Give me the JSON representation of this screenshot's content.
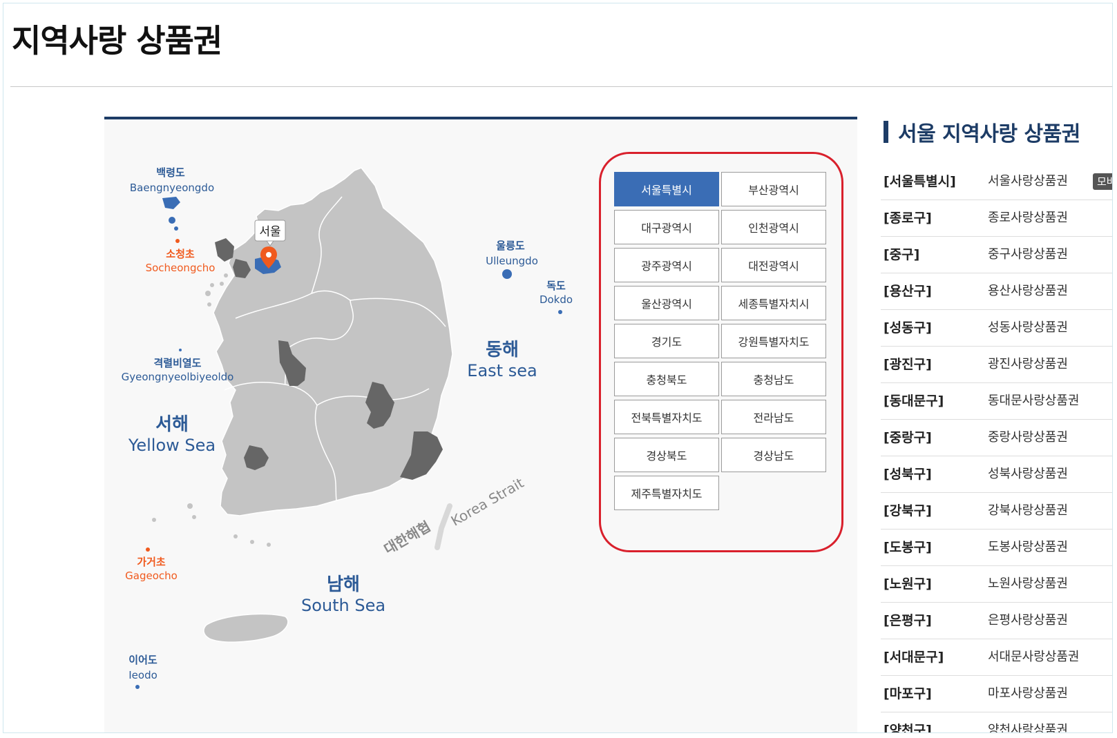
{
  "page": {
    "title": "지역사랑 상품권"
  },
  "map": {
    "labels": {
      "baengnyeongdo_kr": "백령도",
      "baengnyeongdo_en": "Baengnyeongdo",
      "socheongcho_kr": "소청초",
      "socheongcho_en": "Socheongcho",
      "seoul": "서울",
      "ulleungdo_kr": "울릉도",
      "ulleungdo_en": "Ulleungdo",
      "dokdo_kr": "독도",
      "dokdo_en": "Dokdo",
      "gyeongnyeolbiyeoldo_kr": "격렬비열도",
      "gyeongnyeolbiyeoldo_en": "Gyeongnyeolbiyeoldo",
      "yellow_sea_kr": "서해",
      "yellow_sea_en": "Yellow Sea",
      "east_sea_kr": "동해",
      "east_sea_en": "East sea",
      "korea_strait_kr": "대한해협",
      "korea_strait_en": "Korea Strait",
      "gageocho_kr": "가거초",
      "gageocho_en": "Gageocho",
      "south_sea_kr": "남해",
      "south_sea_en": "South Sea",
      "ieodo_kr": "이어도",
      "ieodo_en": "Ieodo"
    },
    "colors": {
      "land": "#c4c4c4",
      "highlight": "#666666",
      "seoul": "#3a6db5",
      "marker": "#f05a1e",
      "label_blue": "#2c5a96",
      "label_orange": "#f05a1e"
    }
  },
  "regions": {
    "selected": "서울특별시",
    "items": [
      "서울특별시",
      "부산광역시",
      "대구광역시",
      "인천광역시",
      "광주광역시",
      "대전광역시",
      "울산광역시",
      "세종특별자치시",
      "경기도",
      "강원특별자치도",
      "충청북도",
      "충청남도",
      "전북특별자치도",
      "전라남도",
      "경상북도",
      "경상남도",
      "제주특별자치도"
    ]
  },
  "sidebar": {
    "title": "서울 지역사랑 상품권",
    "badge": "모바일",
    "vouchers": [
      {
        "district": "[서울특별시]",
        "name": "서울사랑상품권"
      },
      {
        "district": "[종로구]",
        "name": "종로사랑상품권"
      },
      {
        "district": "[중구]",
        "name": "중구사랑상품권"
      },
      {
        "district": "[용산구]",
        "name": "용산사랑상품권"
      },
      {
        "district": "[성동구]",
        "name": "성동사랑상품권"
      },
      {
        "district": "[광진구]",
        "name": "광진사랑상품권"
      },
      {
        "district": "[동대문구]",
        "name": "동대문사랑상품권"
      },
      {
        "district": "[중랑구]",
        "name": "중랑사랑상품권"
      },
      {
        "district": "[성북구]",
        "name": "성북사랑상품권"
      },
      {
        "district": "[강북구]",
        "name": "강북사랑상품권"
      },
      {
        "district": "[도봉구]",
        "name": "도봉사랑상품권"
      },
      {
        "district": "[노원구]",
        "name": "노원사랑상품권"
      },
      {
        "district": "[은평구]",
        "name": "은평사랑상품권"
      },
      {
        "district": "[서대문구]",
        "name": "서대문사랑상품권"
      },
      {
        "district": "[마포구]",
        "name": "마포사랑상품권"
      },
      {
        "district": "[양천구]",
        "name": "양천사랑상품권"
      }
    ]
  }
}
